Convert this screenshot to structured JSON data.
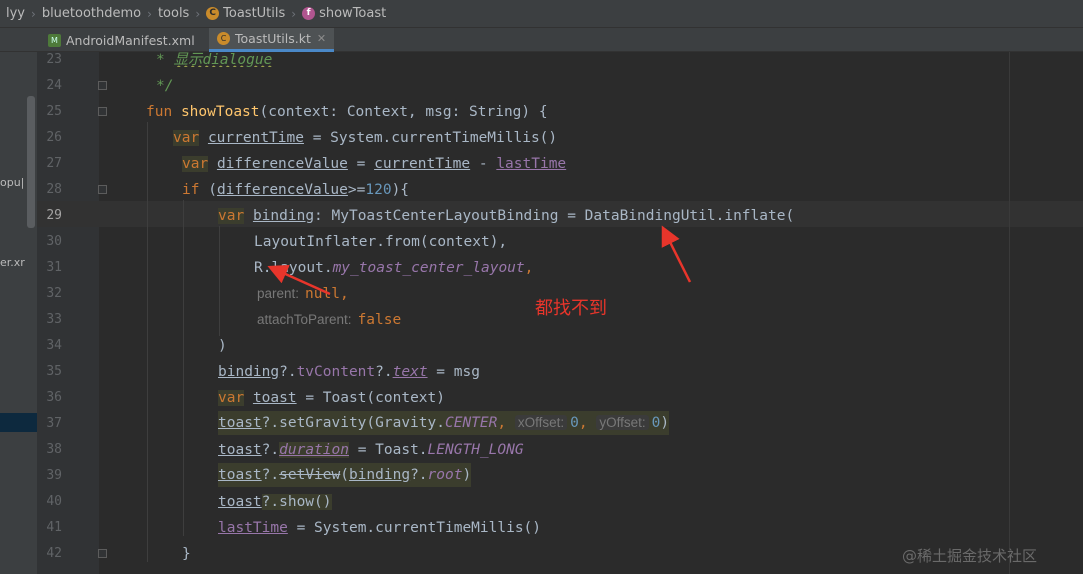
{
  "breadcrumb": {
    "items": [
      "lyy",
      "bluetoothdemo",
      "tools",
      "ToastUtils",
      "showToast"
    ],
    "icons": [
      "",
      "",
      "",
      "class-icon",
      "function-icon"
    ]
  },
  "tabs": [
    {
      "label": "AndroidManifest.xml",
      "icon": "manifest-icon",
      "active": false
    },
    {
      "label": "ToastUtils.kt",
      "icon": "kotlin-class-icon",
      "active": true
    }
  ],
  "left_panel": {
    "fragments": [
      "opu|",
      "er.xr"
    ]
  },
  "editor": {
    "current_line": 29,
    "line_numbers": [
      "23",
      "24",
      "25",
      "26",
      "27",
      "28",
      "29",
      "30",
      "31",
      "32",
      "33",
      "34",
      "35",
      "36",
      "37",
      "38",
      "39",
      "40",
      "41",
      "42"
    ],
    "tokens": {
      "comment_star": "* ",
      "comment_text": "显示dialogue",
      "comment_end": "*/",
      "fun": "fun",
      "showToast": "showToast",
      "sig": "(context: Context, msg: String) {",
      "var": "var",
      "currentTime": "currentTime",
      "eq": " = ",
      "sysMillis": "System.currentTimeMillis()",
      "differenceValue": "differenceValue",
      "minus": " - ",
      "lastTime": "lastTime",
      "if": "if",
      "cond_open": " (",
      "cond_ge": ">=",
      "num120": "120",
      "cond_close": "){",
      "binding": "binding",
      "colon_type": ": MyToastCenterLayoutBinding = DataBindingUtil.inflate(",
      "inflater": "LayoutInflater.from(context),",
      "r_layout": "R.layout.",
      "my_layout": "my_toast_center_layout",
      "comma": ",",
      "parent_hint": "parent:",
      "null": "null",
      "attach_hint": "attachToParent:",
      "false": "false",
      "close_paren": ")",
      "safe_tv": "?.",
      "tvContent": "tvContent",
      "text": "text",
      "eq_msg": " = msg",
      "toast": "toast",
      "toast_ctor": " = Toast(context)",
      "setGravity": "?.setGravity(Gravity.",
      "CENTER": "CENTER",
      "xOffset_hint": "xOffset:",
      "zero": "0",
      "yOffset_hint": "yOffset:",
      "duration": "duration",
      "toast_long": " = Toast.",
      "LENGTH_LONG": "LENGTH_LONG",
      "setView": "setView",
      "root": "root",
      "show": "?.show()",
      "close_brace": "}"
    }
  },
  "annotation": {
    "text": "都找不到",
    "color": "#e8352b"
  },
  "watermark": "@稀土掘金技术社区"
}
